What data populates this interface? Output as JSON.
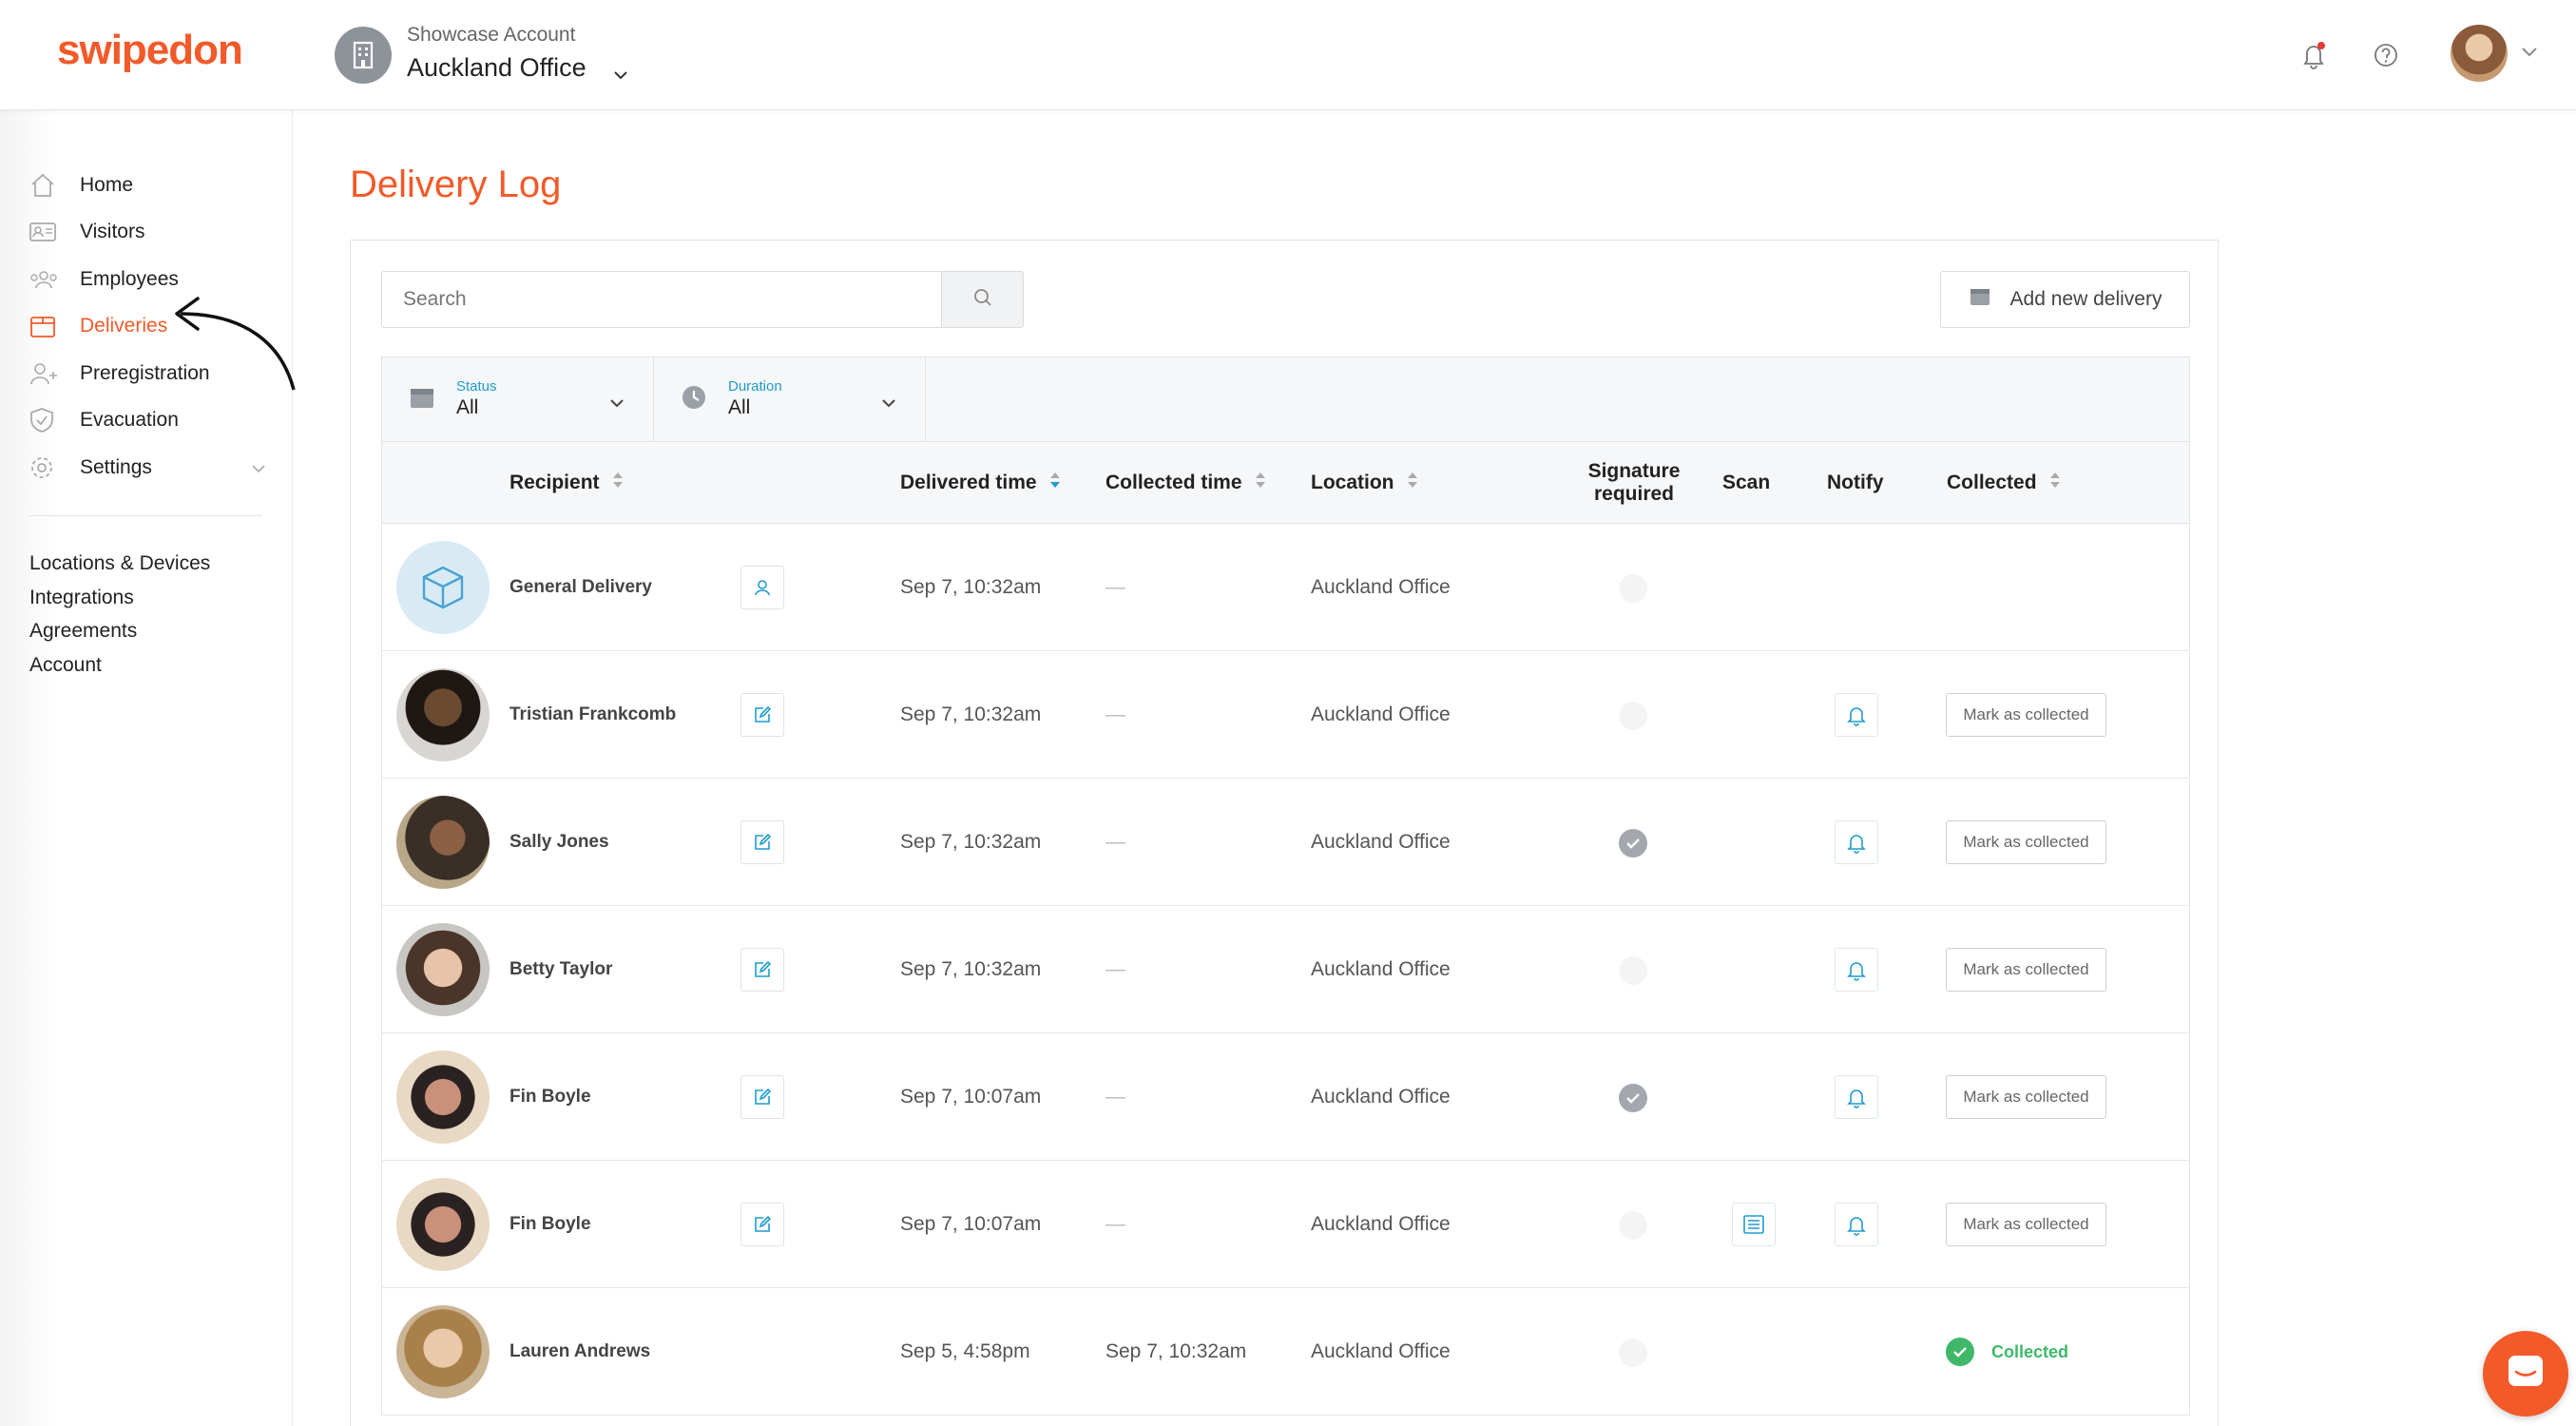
{
  "app": {
    "logo": "swipedon"
  },
  "account": {
    "subtitle": "Showcase Account",
    "name": "Auckland Office"
  },
  "sidebar": {
    "items": [
      {
        "label": "Home",
        "icon": "home-icon"
      },
      {
        "label": "Visitors",
        "icon": "visitor-card-icon"
      },
      {
        "label": "Employees",
        "icon": "employees-icon"
      },
      {
        "label": "Deliveries",
        "icon": "package-icon",
        "active": true
      },
      {
        "label": "Preregistration",
        "icon": "user-add-icon"
      },
      {
        "label": "Evacuation",
        "icon": "shield-icon"
      },
      {
        "label": "Settings",
        "icon": "gear-icon"
      }
    ],
    "secondary": [
      "Locations & Devices",
      "Integrations",
      "Agreements",
      "Account"
    ]
  },
  "page": {
    "title": "Delivery Log"
  },
  "search": {
    "placeholder": "Search"
  },
  "add_delivery": {
    "label": "Add new delivery"
  },
  "filters": {
    "status": {
      "label": "Status",
      "value": "All"
    },
    "duration": {
      "label": "Duration",
      "value": "All"
    }
  },
  "columns": {
    "recipient": "Recipient",
    "delivered_time": "Delivered time",
    "collected_time": "Collected time",
    "location": "Location",
    "signature_line1": "Signature",
    "signature_line2": "required",
    "scan": "Scan",
    "notify": "Notify",
    "collected": "Collected"
  },
  "rows": [
    {
      "recipient": "General Delivery",
      "delivered": "Sep 7, 10:32am",
      "collected_time": "—",
      "location": "Auckland Office",
      "signature": false,
      "scan": false,
      "notify": false,
      "status": ""
    },
    {
      "recipient": "Tristian Frankcomb",
      "delivered": "Sep 7, 10:32am",
      "collected_time": "—",
      "location": "Auckland Office",
      "signature": false,
      "scan": false,
      "notify": true,
      "status": "Mark as collected"
    },
    {
      "recipient": "Sally Jones",
      "delivered": "Sep 7, 10:32am",
      "collected_time": "—",
      "location": "Auckland Office",
      "signature": true,
      "scan": false,
      "notify": true,
      "status": "Mark as collected"
    },
    {
      "recipient": "Betty Taylor",
      "delivered": "Sep 7, 10:32am",
      "collected_time": "—",
      "location": "Auckland Office",
      "signature": false,
      "scan": false,
      "notify": true,
      "status": "Mark as collected"
    },
    {
      "recipient": "Fin Boyle",
      "delivered": "Sep 7, 10:07am",
      "collected_time": "—",
      "location": "Auckland Office",
      "signature": true,
      "scan": false,
      "notify": true,
      "status": "Mark as collected"
    },
    {
      "recipient": "Fin Boyle",
      "delivered": "Sep 7, 10:07am",
      "collected_time": "—",
      "location": "Auckland Office",
      "signature": false,
      "scan": true,
      "notify": true,
      "status": "Mark as collected"
    },
    {
      "recipient": "Lauren Andrews",
      "delivered": "Sep 5, 4:58pm",
      "collected_time": "Sep 7, 10:32am",
      "location": "Auckland Office",
      "signature": false,
      "scan": false,
      "notify": false,
      "status": "Collected"
    }
  ],
  "colors": {
    "brand": "#f25a2a",
    "accent": "#1f9ccf",
    "success": "#3fb868"
  }
}
